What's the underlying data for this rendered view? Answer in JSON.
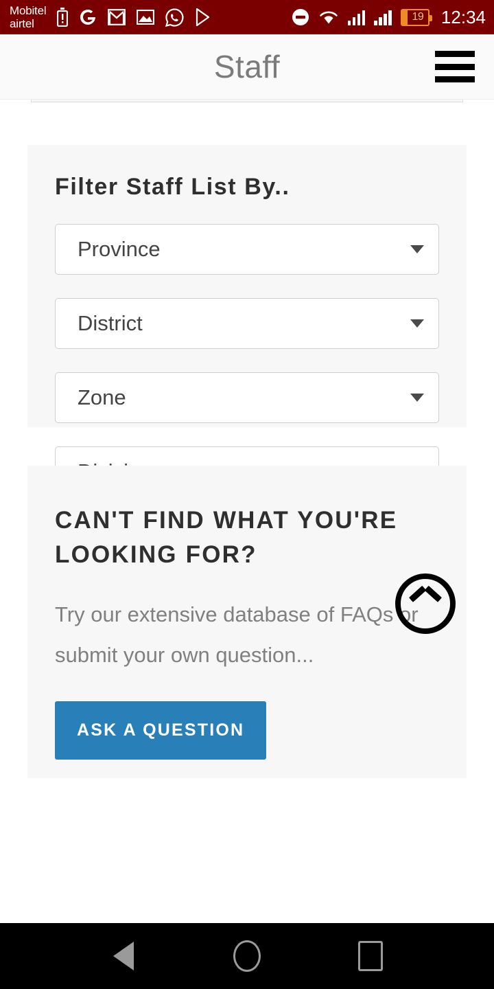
{
  "status_bar": {
    "carrier": "Mobitel\nairtel",
    "background_color": "#7a0000",
    "left_icons": [
      {
        "name": "battery-alert-icon",
        "glyph": "battery-alert"
      },
      {
        "name": "google-icon",
        "glyph": "G"
      },
      {
        "name": "gmail-icon",
        "glyph": "M"
      },
      {
        "name": "gallery-icon",
        "glyph": "image"
      },
      {
        "name": "whatsapp-icon",
        "glyph": "phone-circle"
      },
      {
        "name": "play-store-icon",
        "glyph": "play"
      }
    ],
    "right_icons": [
      {
        "name": "do-not-disturb-icon",
        "glyph": "minus-circle"
      },
      {
        "name": "wifi-icon",
        "glyph": "wifi"
      },
      {
        "name": "signal-sim1-icon",
        "glyph": "bars"
      },
      {
        "name": "signal-sim2-icon",
        "glyph": "bars"
      }
    ],
    "battery_percent": "19",
    "battery_color": "#f08a24",
    "clock": "12:34"
  },
  "app_header": {
    "title": "Staff",
    "menu_icon": "hamburger-menu-icon",
    "background_color": "#fafafa",
    "title_color": "#7b7b7b"
  },
  "filter_card": {
    "title": "Filter Staff List By..",
    "selects": [
      {
        "name": "province",
        "value": "Province",
        "caret": "chevron-down-icon"
      },
      {
        "name": "district",
        "value": "District",
        "caret": "chevron-down-icon"
      },
      {
        "name": "zone",
        "value": "Zone",
        "caret": "chevron-down-icon"
      },
      {
        "name": "division",
        "value": "Division",
        "caret": "chevron-down-icon"
      }
    ]
  },
  "faq_card": {
    "heading": "CAN'T FIND WHAT YOU'RE LOOKING FOR?",
    "body": "Try our extensive database of FAQs or submit your own question...",
    "button_label": "ASK A QUESTION",
    "button_color": "#2980b9"
  },
  "scroll_to_top": {
    "icon": "chevron-up-circle-icon"
  },
  "nav_bar": {
    "background_color": "#000000",
    "buttons": [
      {
        "name": "nav-back-button",
        "icon": "triangle-left-icon"
      },
      {
        "name": "nav-home-button",
        "icon": "circle-icon"
      },
      {
        "name": "nav-recents-button",
        "icon": "square-icon"
      }
    ]
  }
}
